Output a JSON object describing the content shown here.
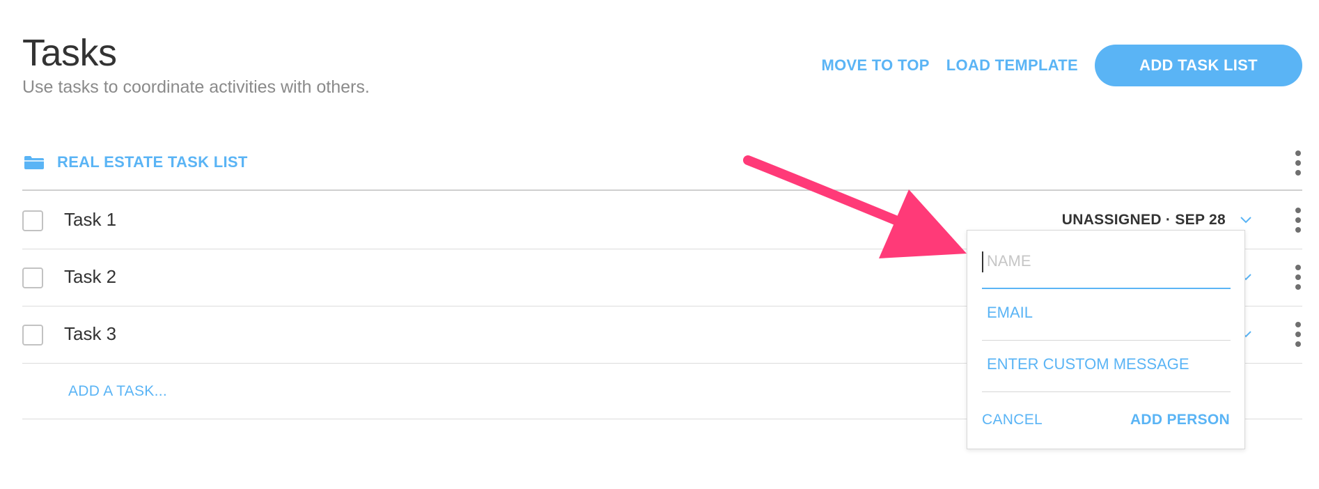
{
  "header": {
    "title": "Tasks",
    "subtitle": "Use tasks to coordinate activities with others.",
    "move_to_top": "MOVE TO TOP",
    "load_template": "LOAD TEMPLATE",
    "add_task_list": "ADD TASK LIST"
  },
  "task_list": {
    "title": "REAL ESTATE TASK LIST",
    "icon": "folder-icon",
    "tasks": [
      {
        "name": "Task 1",
        "assignment": "UNASSIGNED · SEP 28",
        "checked": false
      },
      {
        "name": "Task 2",
        "assignment": "",
        "checked": false
      },
      {
        "name": "Task 3",
        "assignment": "",
        "checked": false
      }
    ],
    "add_task_label": "ADD A TASK..."
  },
  "assign_popover": {
    "name_placeholder": "NAME",
    "email_placeholder": "EMAIL",
    "message_placeholder": "ENTER CUSTOM MESSAGE",
    "cancel_label": "CANCEL",
    "add_person_label": "ADD PERSON"
  },
  "colors": {
    "accent": "#5ab4f5",
    "annotation_arrow": "#ff3a78",
    "text": "#333333",
    "muted": "#8a8a8a"
  }
}
